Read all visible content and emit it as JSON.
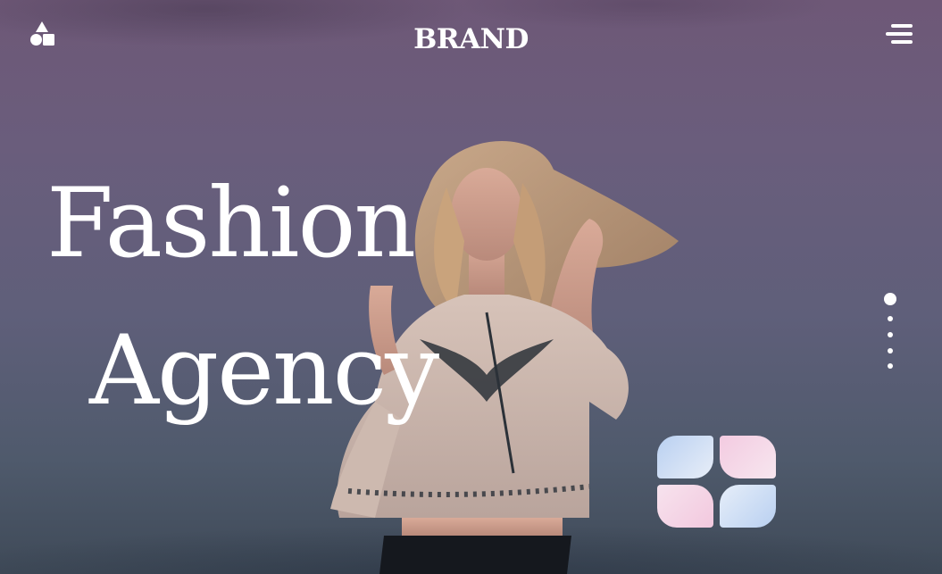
{
  "header": {
    "brand": "BRAND",
    "logo_icon": "shapes-icon",
    "menu_icon": "hamburger-menu-icon"
  },
  "hero": {
    "headline_line1": "Fashion",
    "headline_line2": "Agency"
  },
  "slider": {
    "total_slides": 5,
    "active_index": 0
  },
  "decor": {
    "tile_colors": [
      "#b9d0f1",
      "#f3cbe1",
      "#f2c8de",
      "#b9d0f1"
    ]
  }
}
